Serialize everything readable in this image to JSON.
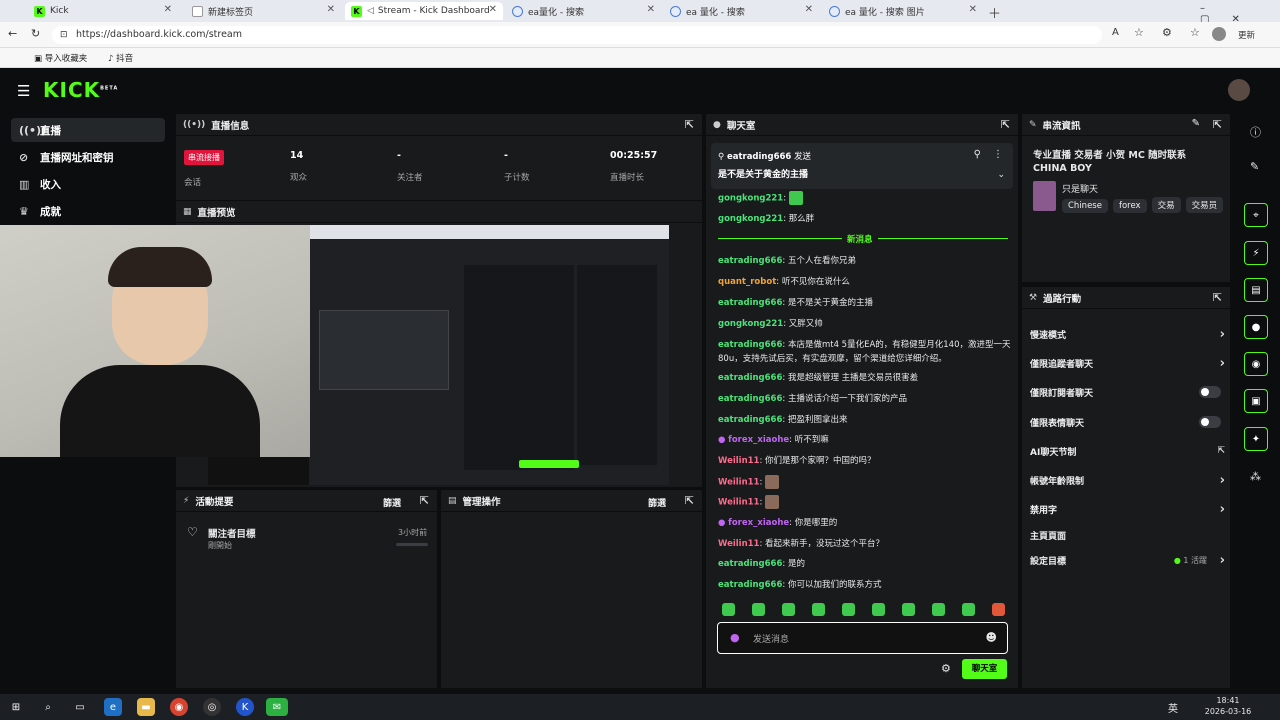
{
  "browser": {
    "tabs": [
      {
        "title": "Kick",
        "icon": "kick-icon"
      },
      {
        "title": "新建标签页",
        "icon": "newtab-icon"
      },
      {
        "title": "Stream - Kick Dashboard",
        "icon": "kick-icon"
      },
      {
        "title": "ea量化 - 搜索",
        "icon": "bing-icon"
      },
      {
        "title": "ea 量化 - 搜索",
        "icon": "bing-icon"
      },
      {
        "title": "ea 量化 - 搜索 图片",
        "icon": "bing-icon"
      }
    ],
    "url": "https://dashboard.kick.com/stream",
    "bookmarks": [
      "导入收藏夹",
      "抖音"
    ],
    "profile_label": "更新"
  },
  "app": {
    "logo": "KICK",
    "logo_sup": "BETA",
    "sidebar": [
      {
        "label": "直播",
        "icon": "broadcast-icon"
      },
      {
        "label": "直播网址和密钥",
        "icon": "link-icon"
      },
      {
        "label": "收入",
        "icon": "chart-icon"
      },
      {
        "label": "成就",
        "icon": "trophy-icon"
      }
    ]
  },
  "stream_info": {
    "title": "直播信息",
    "badge": "串流接播",
    "session_label": "会话",
    "stats": [
      {
        "value": "14",
        "label": "观众"
      },
      {
        "value": "-",
        "label": "关注者"
      },
      {
        "value": "-",
        "label": "子计数"
      },
      {
        "value": "00:25:57",
        "label": "直播时长"
      }
    ]
  },
  "preview": {
    "title": "直播预览"
  },
  "activity": {
    "title": "活動提要",
    "filter": "篩選",
    "goal_title": "關注者目標",
    "goal_sub": "剛開始",
    "goal_time": "3小时前"
  },
  "mod": {
    "title": "管理操作",
    "filter": "篩選"
  },
  "chat": {
    "title": "聊天室",
    "pinned_user": "eatrading666",
    "pinned_verb": "发送",
    "pinned_text": "是不是关于黄金的主播",
    "new_messages": "新消息",
    "messages": [
      {
        "user": "gongkong221",
        "text": "",
        "color": "g"
      },
      {
        "user": "gongkong221",
        "text": "那么胖",
        "color": "g"
      },
      {
        "user": "eatrading666",
        "text": "五个人在看你兄弟",
        "color": "g"
      },
      {
        "user": "quant_robot",
        "text": "听不见你在说什么",
        "color": "o"
      },
      {
        "user": "eatrading666",
        "text": "是不是关于黄金的主播",
        "color": "g"
      },
      {
        "user": "gongkong221",
        "text": "又胖又帅",
        "color": "g"
      },
      {
        "user": "eatrading666",
        "text": "本店是做mt4 5量化EA的，有稳健型月化140，激进型一天80u，支持先试后买，有实盘观摩，留个渠道给您详细介绍。",
        "color": "g"
      },
      {
        "user": "eatrading666",
        "text": "我是超级管理 主播是交易员很害羞",
        "color": "g"
      },
      {
        "user": "eatrading666",
        "text": "主播说话介绍一下我们家的产品",
        "color": "g"
      },
      {
        "user": "eatrading666",
        "text": "把盈利图拿出来",
        "color": "g"
      },
      {
        "user": "forex_xiaohe",
        "text": "听不到嘛",
        "color": "p"
      },
      {
        "user": "Weilin11",
        "text": "你们是那个家啊？中国的吗？",
        "color": "r"
      },
      {
        "user": "Weilin11",
        "text": "",
        "color": "r"
      },
      {
        "user": "Weilin11",
        "text": "",
        "color": "r"
      },
      {
        "user": "forex_xiaohe",
        "text": "你是哪里的",
        "color": "p"
      },
      {
        "user": "Weilin11",
        "text": "看起来新手，没玩过这个平台？",
        "color": "r"
      },
      {
        "user": "eatrading666",
        "text": "是的",
        "color": "g"
      },
      {
        "user": "eatrading666",
        "text": "你可以加我们的联系方式",
        "color": "g"
      }
    ],
    "input_placeholder": "发送消息",
    "send_label": "聊天室"
  },
  "stream_card": {
    "title": "串流資訊",
    "stream_title": "专业直播 交易者 小贺 MC 随时联系 CHINA BOY",
    "category": "只是聊天",
    "tags": [
      "Chinese",
      "forex",
      "交易",
      "交易员"
    ]
  },
  "quick_actions": {
    "title": "過路行動",
    "items": [
      {
        "label": "慢速模式",
        "control": "chevron"
      },
      {
        "label": "僅限追蹤者聊天",
        "control": "chevron"
      },
      {
        "label": "僅限訂閱者聊天",
        "control": "toggle"
      },
      {
        "label": "僅限表情聊天",
        "control": "toggle"
      },
      {
        "label": "AI聊天节制",
        "control": "external"
      },
      {
        "label": "帳號年齡限制",
        "control": "chevron"
      },
      {
        "label": "禁用字",
        "control": "chevron"
      },
      {
        "label": "主頁頁面",
        "control": "none"
      },
      {
        "label": "設定目標",
        "control": "chevron",
        "badge": "1 活躍"
      }
    ]
  },
  "taskbar": {
    "time": "18:41",
    "date": "2026-03-16",
    "lang": "英"
  },
  "colors": {
    "kick_green": "#53fc18",
    "panel": "#181a1c",
    "bg": "#0b0d0e",
    "badge_red": "#e1143c"
  }
}
